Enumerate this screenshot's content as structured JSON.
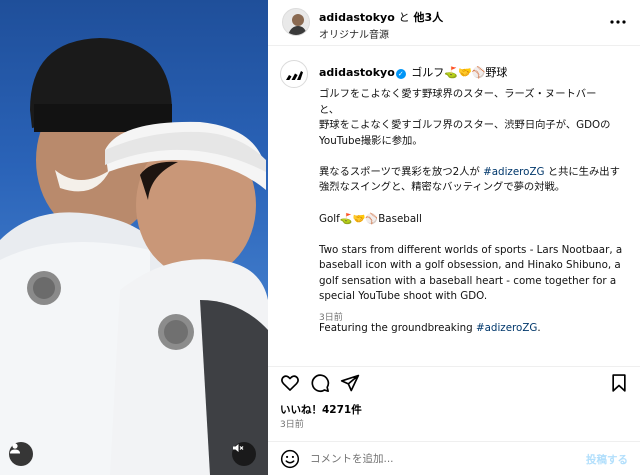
{
  "header": {
    "username": "adidastokyo",
    "joiner": "と",
    "others": "他3人",
    "audio": "オリジナル音源"
  },
  "caption": {
    "username": "adidastokyo",
    "verified_icon": "check-icon",
    "title": "ゴルフ⛳🤝⚾野球",
    "paragraphs": [
      "ゴルフをこよなく愛す野球界のスター、ラーズ・ヌートバー\nと、\n野球をこよなく愛すゴルフ界のスター、渋野日向子が、GDOの\nYouTube撮影に参加。",
      "異なるスポーツで異彩を放つ2人が",
      "Golf⛳🤝⚾Baseball",
      "Two stars from different worlds of sports - Lars Nootbaar, a baseball icon with a golf obsession, and Hinako Shibuno, a golf sensation with a baseball heart - come together for a special YouTube shoot with GDO.",
      "Featuring the groundbreaking"
    ],
    "p2_hashtag": "#adizeroZG",
    "p2_after": "と共に生み出す\n強烈なスイングと、精密なバッティングで夢の対戦。",
    "p5_hashtag": "#adizeroZG",
    "p5_after": ".",
    "time": "3日前"
  },
  "actions": {
    "like_icon": "heart-icon",
    "comment_icon": "comment-icon",
    "share_icon": "send-icon",
    "save_icon": "bookmark-icon"
  },
  "likes": "いいね！4271件",
  "post_time": "3日前",
  "comment": {
    "placeholder": "コメントを追加...",
    "post_label": "投稿する"
  },
  "colors": {
    "verified": "#0095f6",
    "hashtag": "#00376b",
    "post_disabled": "#b2dffc"
  }
}
